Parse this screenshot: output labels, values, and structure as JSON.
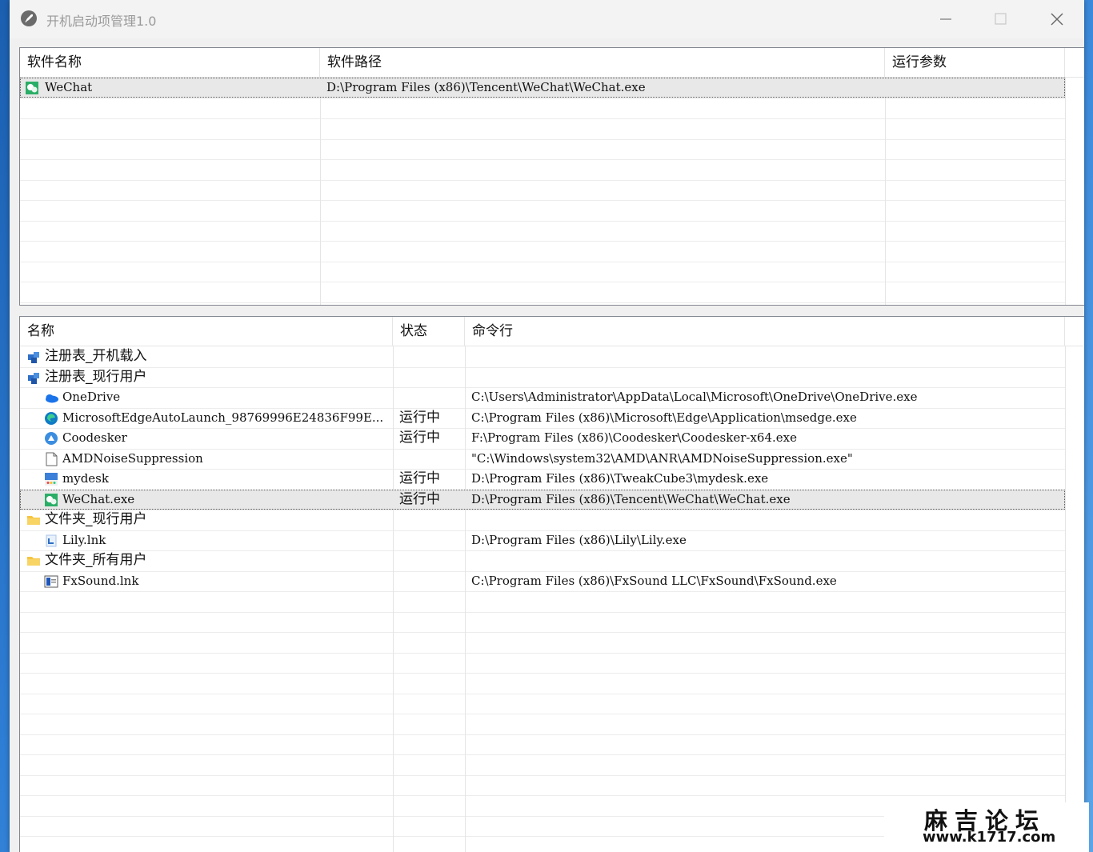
{
  "window": {
    "title": "开机启动项管理1.0"
  },
  "top_table": {
    "columns": [
      "软件名称",
      "软件路径",
      "运行参数"
    ],
    "rows": [
      {
        "name": "WeChat",
        "path": "D:\\Program Files (x86)\\Tencent\\WeChat\\WeChat.exe",
        "args": "",
        "icon": "wechat-icon"
      }
    ]
  },
  "bottom_table": {
    "columns": [
      "名称",
      "状态",
      "命令行"
    ],
    "rows": [
      {
        "level": 0,
        "name": "注册表_开机载入",
        "status": "",
        "command": "",
        "icon": "registry-icon"
      },
      {
        "level": 0,
        "name": "注册表_现行用户",
        "status": "",
        "command": "",
        "icon": "registry-icon"
      },
      {
        "level": 1,
        "name": "OneDrive",
        "status": "",
        "command": "C:\\Users\\Administrator\\AppData\\Local\\Microsoft\\OneDrive\\OneDrive.exe",
        "icon": "onedrive-icon"
      },
      {
        "level": 1,
        "name": "MicrosoftEdgeAutoLaunch_98769996E24836F99E...",
        "status": "运行中",
        "command": "C:\\Program Files (x86)\\Microsoft\\Edge\\Application\\msedge.exe",
        "icon": "edge-icon"
      },
      {
        "level": 1,
        "name": "Coodesker",
        "status": "运行中",
        "command": "F:\\Program Files (x86)\\Coodesker\\Coodesker-x64.exe",
        "icon": "coodesker-icon"
      },
      {
        "level": 1,
        "name": "AMDNoiseSuppression",
        "status": "",
        "command": "\"C:\\Windows\\system32\\AMD\\ANR\\AMDNoiseSuppression.exe\"",
        "icon": "file-icon"
      },
      {
        "level": 1,
        "name": "mydesk",
        "status": "运行中",
        "command": "D:\\Program Files (x86)\\TweakCube3\\mydesk.exe",
        "icon": "mydesk-icon"
      },
      {
        "level": 1,
        "name": "WeChat.exe",
        "status": "运行中",
        "command": "D:\\Program Files (x86)\\Tencent\\WeChat\\WeChat.exe",
        "icon": "wechat-icon",
        "selected": true
      },
      {
        "level": 0,
        "name": "文件夹_现行用户",
        "status": "",
        "command": "",
        "icon": "folder-icon"
      },
      {
        "level": 1,
        "name": "Lily.lnk",
        "status": "",
        "command": "D:\\Program Files (x86)\\Lily\\Lily.exe",
        "icon": "lily-icon"
      },
      {
        "level": 0,
        "name": "文件夹_所有用户",
        "status": "",
        "command": "",
        "icon": "folder-icon"
      },
      {
        "level": 1,
        "name": "FxSound.lnk",
        "status": "",
        "command": "C:\\Program Files (x86)\\FxSound LLC\\FxSound\\FxSound.exe",
        "icon": "fxsound-icon"
      }
    ]
  },
  "watermark": {
    "title": "麻吉论坛",
    "url": "www.k1717.com"
  }
}
